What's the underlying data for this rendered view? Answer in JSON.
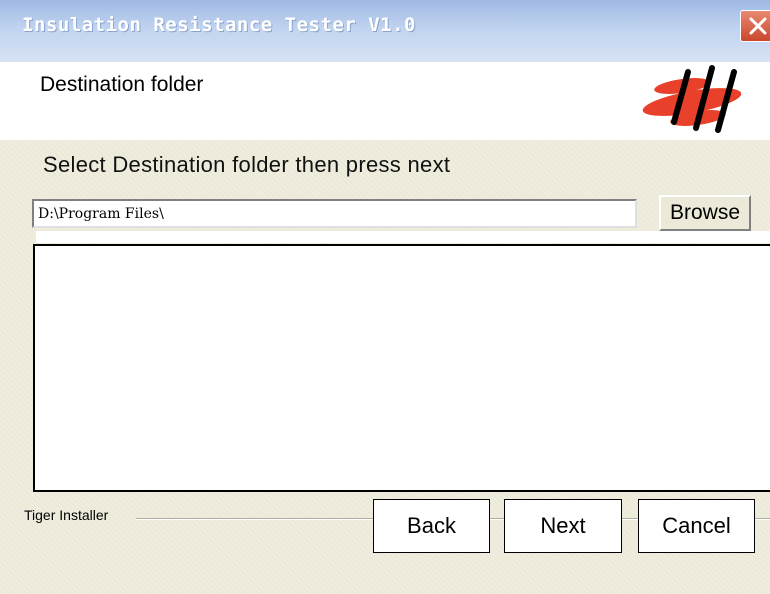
{
  "window": {
    "title": "Insulation Resistance Tester V1.0"
  },
  "header": {
    "title": "Destination folder"
  },
  "main": {
    "instruction": "Select Destination folder then press next",
    "path_value": "D:\\Program Files\\",
    "browse_label": "Browse"
  },
  "footer": {
    "group_label": "Tiger Installer",
    "back_label": "Back",
    "next_label": "Next",
    "cancel_label": "Cancel"
  },
  "icons": {
    "close": "close-icon",
    "logo": "brand-logo-icon"
  },
  "colors": {
    "titlebar": "#9fb9e4",
    "close_button": "#d45a3d",
    "logo_red": "#e8402a",
    "dialog_bg": "#ece9d8"
  }
}
